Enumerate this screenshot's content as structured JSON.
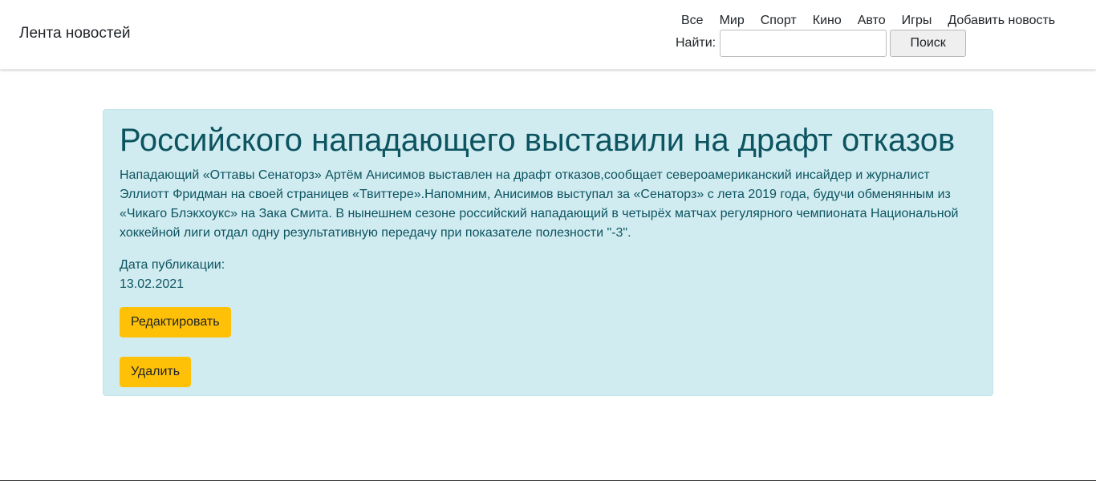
{
  "header": {
    "brand": "Лента новостей",
    "nav": [
      {
        "label": "Все"
      },
      {
        "label": "Мир"
      },
      {
        "label": "Спорт"
      },
      {
        "label": "Кино"
      },
      {
        "label": "Авто"
      },
      {
        "label": "Игры"
      },
      {
        "label": "Добавить новость"
      }
    ],
    "search": {
      "label": "Найти:",
      "value": "",
      "placeholder": "",
      "button_label": "Поиск"
    }
  },
  "article": {
    "title": "Российского нападающего выставили на драфт отказов",
    "body": "Нападающий «Оттавы Сенаторз» Артём Анисимов выставлен на драфт отказов,сообщает североамериканский инсайдер и журналист Эллиотт Фридман на своей страницев «Твиттере».Напомним, Анисимов выступал за «Сенаторз» с лета 2019 года, будучи обменянным из «Чикаго Блэкхоукс» на Зака Смита. В нынешнем сезоне российский нападающий в четырёх матчах регулярного чемпионата Национальной хоккейной лиги отдал одну результативную передачу при показателе полезности \"-3\".",
    "pub_label": "Дата публикации:",
    "pub_date": "13.02.2021",
    "edit_label": "Редактировать",
    "delete_label": "Удалить"
  },
  "colors": {
    "card_bg": "#d1ecf1",
    "card_text": "#0c5460",
    "button_warning": "#ffc107"
  }
}
